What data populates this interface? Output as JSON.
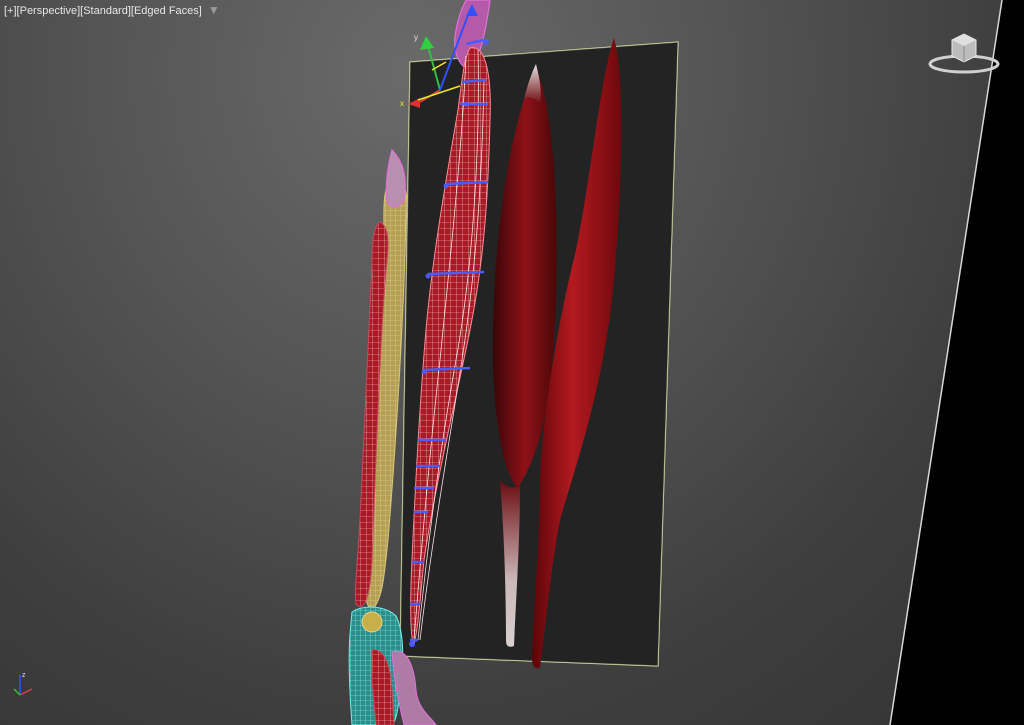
{
  "viewport": {
    "label_plus": "[+]",
    "label_view": "[Perspective]",
    "label_shading": "[Standard]",
    "label_style": "[Edged Faces]",
    "filter_icon": "funnel-icon"
  },
  "colors": {
    "muscle_red": "#8b0f12",
    "wire_blue": "#3a4bff",
    "bone_yellow": "#c8b24a",
    "bone_pink": "#d04cc0",
    "plane_edge": "#e6e6b0",
    "wire_cyan": "#50e0e0"
  },
  "icons": [
    "viewcube-icon",
    "transform-gizmo-icon",
    "world-axis-icon",
    "funnel-icon"
  ]
}
